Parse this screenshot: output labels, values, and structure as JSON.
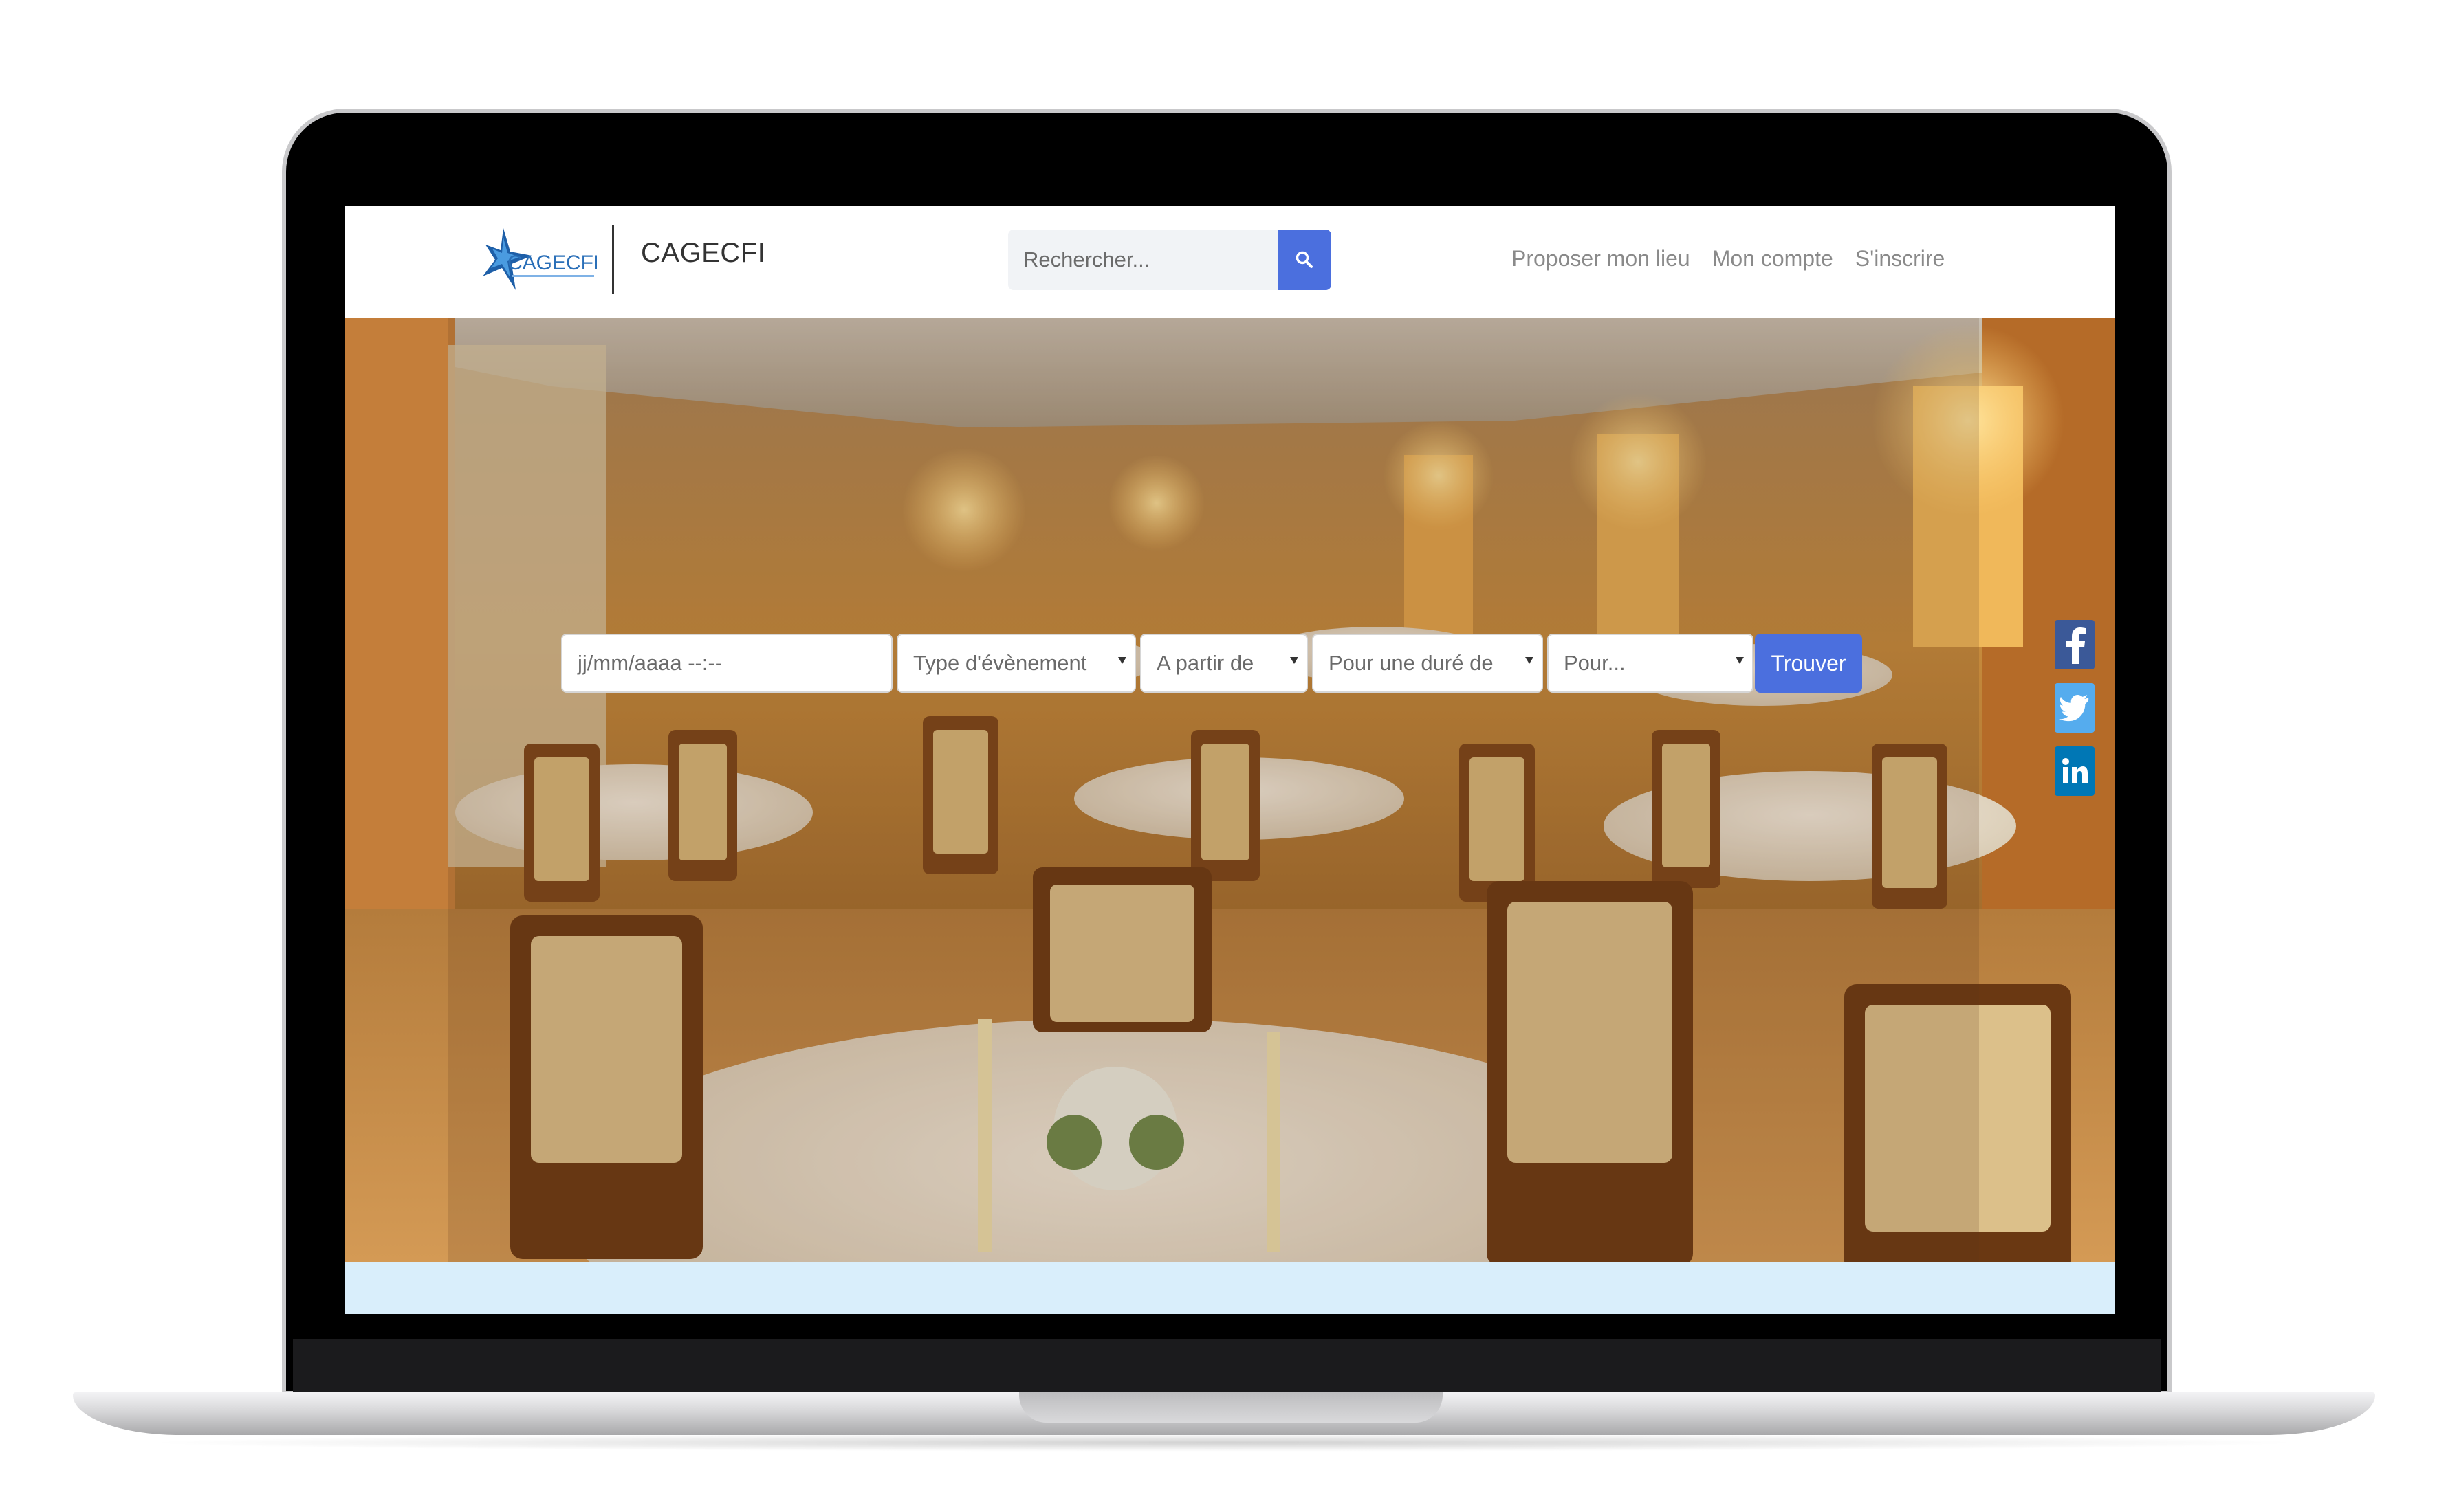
{
  "brand": {
    "name": "CAGECFI",
    "logo_text": "CAGECFI"
  },
  "search": {
    "placeholder": "Rechercher..."
  },
  "nav": {
    "links": [
      "Proposer mon lieu",
      "Mon compte",
      "S'inscrire"
    ]
  },
  "event_search": {
    "date_placeholder": "jj/mm/aaaa --:--",
    "event_type": "Type d'évènement",
    "from": "A partir de",
    "duration": "Pour une duré de",
    "guests": "Pour...",
    "submit_label": "Trouver"
  },
  "social": [
    "facebook",
    "twitter",
    "linkedin"
  ],
  "colors": {
    "accent": "#4b6fde",
    "facebook": "#3b5998",
    "twitter": "#55acee",
    "linkedin": "#0077b5",
    "strip": "#d9eefb"
  }
}
